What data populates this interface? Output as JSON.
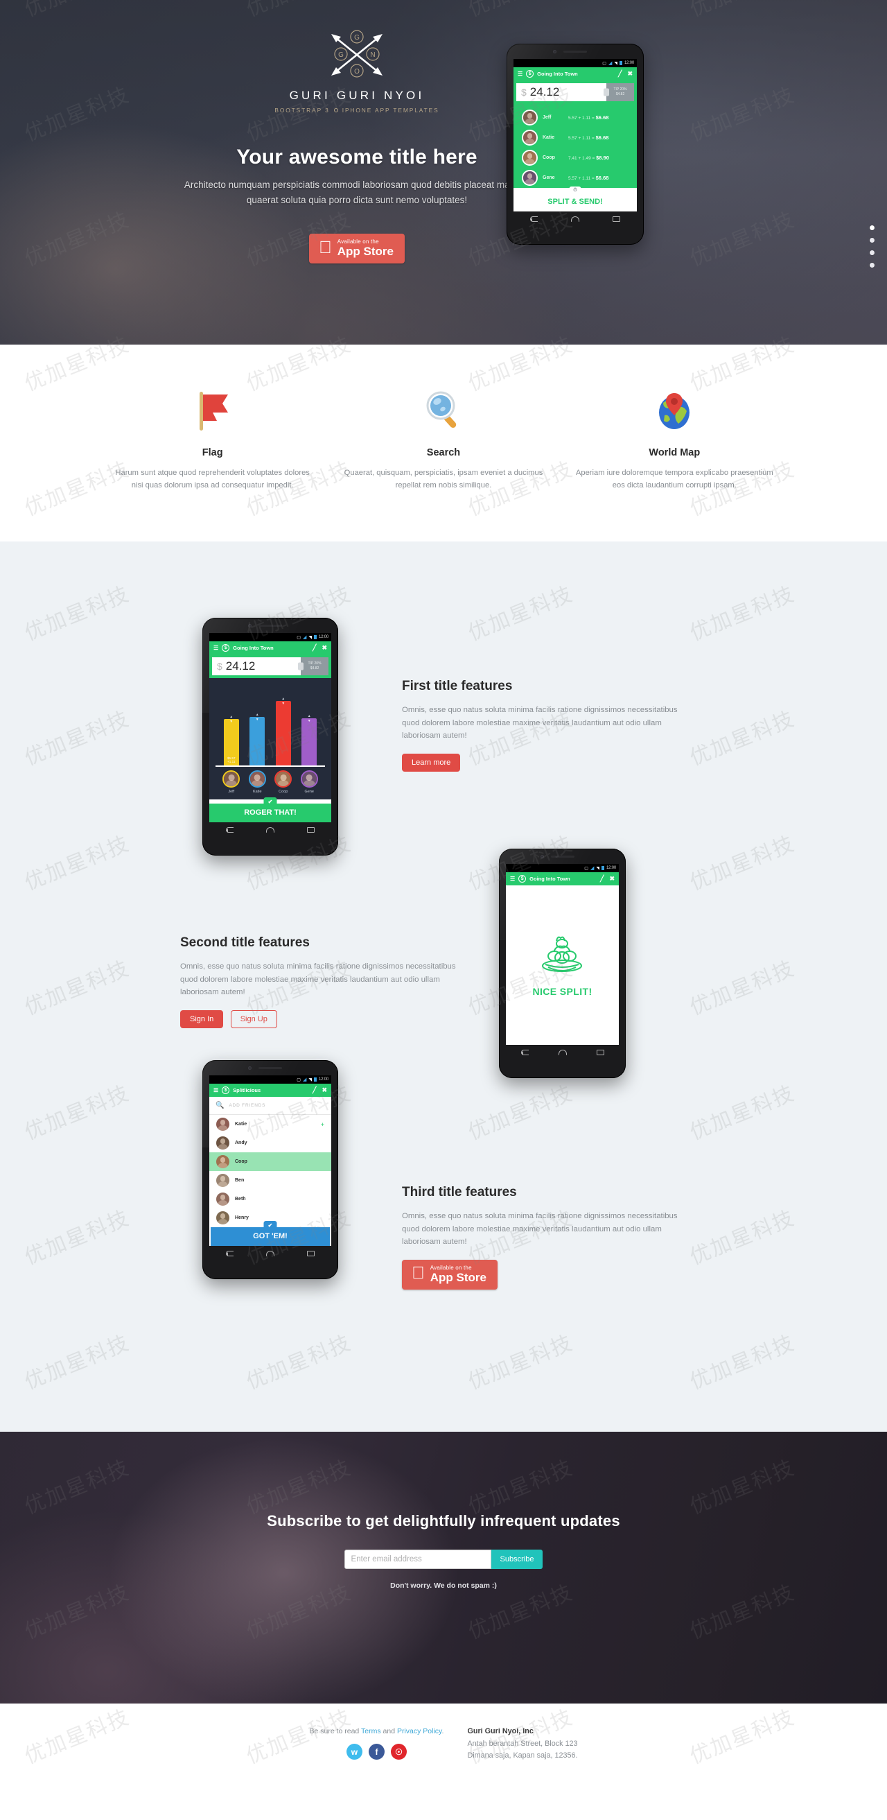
{
  "hero": {
    "brand_name": "GURI GURI NYOI",
    "brand_sub_left": "BOOTSTRAP 3",
    "brand_sub_right": "IPHONE APP TEMPLATES",
    "title": "Your awesome title here",
    "text": "Architecto numquam perspiciatis commodi laboriosam quod debitis placeat maxime quaerat soluta quia porro dicta sunt nemo voluptates!",
    "appstore_line1": "Available on the",
    "appstore_line2": "App Store",
    "dots": [
      "1",
      "2",
      "3",
      "4"
    ],
    "active_dot": 0
  },
  "phone_hero": {
    "status_time": "12:00",
    "app_title": "Going Into Town",
    "currency": "$",
    "amount": "24.12",
    "tip_label": "TIP 20%",
    "tip_value": "$4.82",
    "people": [
      {
        "name": "Jeff",
        "calc": "5.57 + 1.11 = ",
        "total": "$6.68",
        "color": "#7d5a4a"
      },
      {
        "name": "Katie",
        "calc": "5.57 + 1.11 = ",
        "total": "$6.68",
        "color": "#8d5c52"
      },
      {
        "name": "Coop",
        "calc": "7.41 + 1.49 = ",
        "total": "$8.90",
        "color": "#a07250"
      },
      {
        "name": "Gene",
        "calc": "5.57 + 1.11 = ",
        "total": "$6.68",
        "color": "#6a4f6d"
      }
    ],
    "split_button": "SPLIT & SEND!"
  },
  "icon_features": [
    {
      "icon": "flag-icon",
      "title": "Flag",
      "text": "Harum sunt atque quod reprehenderit voluptates dolores nisi quas dolorum ipsa ad consequatur impedit."
    },
    {
      "icon": "magnifier-icon",
      "title": "Search",
      "text": "Quaerat, quisquam, perspiciatis, ipsam eveniet a ducimus repellat rem nobis similique."
    },
    {
      "icon": "world-map-icon",
      "title": "World Map",
      "text": "Aperiam iure doloremque tempora explicabo praesentium eos dicta laudantium corrupti ipsam."
    }
  ],
  "feature_blocks": {
    "first": {
      "title": "First title features",
      "text": "Omnis, esse quo natus soluta minima facilis ratione dignissimos necessitatibus quod dolorem labore molestiae maxime veritatis laudantium aut odio ullam laboriosam autem!",
      "button": "Learn more"
    },
    "second": {
      "title": "Second title features",
      "text": "Omnis, esse quo natus soluta minima facilis ratione dignissimos necessitatibus quod dolorem labore molestiae maxime veritatis laudantium aut odio ullam laboriosam autem!",
      "button_primary": "Sign In",
      "button_secondary": "Sign Up"
    },
    "third": {
      "title": "Third title features",
      "text": "Omnis, esse quo natus soluta minima facilis ratione dignissimos necessitatibus quod dolorem labore molestiae maxime veritatis laudantium aut odio ullam laboriosam autem!",
      "appstore_line1": "Available on the",
      "appstore_line2": "App Store"
    }
  },
  "phone_chart": {
    "status_time": "12:00",
    "app_title": "Going Into Town",
    "currency": "$",
    "amount": "24.12",
    "tip_label": "TIP 20%",
    "tip_value": "$4.82",
    "button": "ROGER THAT!",
    "chart_data": {
      "type": "bar",
      "categories": [
        "Jeff",
        "Katie",
        "Coop",
        "Gene"
      ],
      "values": [
        6.68,
        6.68,
        8.9,
        6.68
      ],
      "bar_colors": [
        "#f2cb1d",
        "#3b9fdc",
        "#ec3b32",
        "#a05ec9"
      ],
      "bar_heights_pct": [
        58,
        60,
        80,
        59
      ],
      "labels": [
        "$5.57",
        "",
        "",
        ""
      ],
      "sublabels": [
        "+1.11",
        "",
        "",
        ""
      ],
      "title": "",
      "xlabel": "",
      "ylabel": "",
      "grid": false,
      "legend": "none"
    }
  },
  "phone_nice": {
    "status_time": "12:00",
    "app_title": "Going Into Town",
    "label": "NICE SPLIT!"
  },
  "phone_friends": {
    "status_time": "12:00",
    "app_title": "Splitlicious",
    "search_placeholder": "ADD FRIENDS",
    "friends": [
      {
        "name": "Katie",
        "selected": false,
        "color": "#8d5c52"
      },
      {
        "name": "Andy",
        "selected": false,
        "color": "#6d5442"
      },
      {
        "name": "Coop",
        "selected": true,
        "color": "#a07250"
      },
      {
        "name": "Ben",
        "selected": false,
        "color": "#9a8472"
      },
      {
        "name": "Beth",
        "selected": false,
        "color": "#8f6a5c"
      },
      {
        "name": "Henry",
        "selected": false,
        "color": "#7e6a50"
      }
    ],
    "button": "GOT 'EM!"
  },
  "subscribe": {
    "title": "Subscribe to get delightfully infrequent updates",
    "email_placeholder": "Enter email address",
    "email_value": "",
    "button": "Subscribe",
    "note": "Don't worry. We do not spam :)"
  },
  "footer": {
    "legal_prefix": "Be sure to read ",
    "terms_link": "Terms",
    "legal_mid": " and ",
    "privacy_link": "Privacy Policy",
    "legal_suffix": ".",
    "socials": [
      "twitter-icon",
      "facebook-icon",
      "pinterest-icon"
    ],
    "company_name": "Guri Guri Nyoi, Inc",
    "address_line1": "Antah berantah Street, Block 123",
    "address_line2": "Dimana saja, Kapan saja, 12356."
  },
  "watermark": "优加星科技"
}
